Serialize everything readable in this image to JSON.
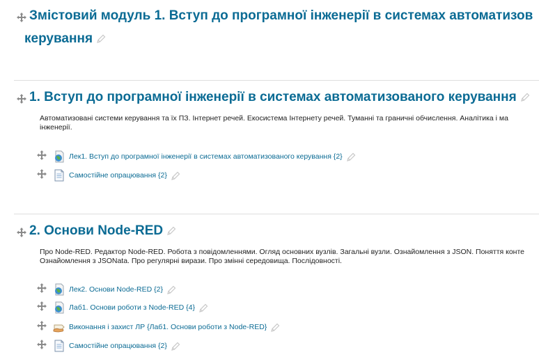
{
  "module": {
    "title_line1": "Змістовий модуль 1. Вступ до програмної інженерії в системах автоматизов",
    "title_line2": "керування"
  },
  "sections": [
    {
      "title": "1. Вступ до програмної інженерії в системах автоматизованого керування",
      "summary_line1": "Автоматизовані системи керування та їх ПЗ. Інтернет речей. Екосистема  Інтернету речей. Туманні та граничні обчислення. Аналітика і ма",
      "summary_line2": "інженерії.",
      "activities": [
        {
          "icon": "globe-icon",
          "label": "Лек1. Вступ до програмної інженерії в системах автоматизованого керування {2}"
        },
        {
          "icon": "page-icon",
          "label": "Самостійне опрацювання {2}"
        }
      ]
    },
    {
      "title": "2. Основи Node-RED",
      "summary_line1": "Про Node-RED. Редактор Node-RED. Робота з повідомленнями. Огляд основних вузлів. Загальні вузли. Ознайомлення з JSON. Поняття конте",
      "summary_line2": "Ознайомлення з JSONata. Про регулярні вирази. Про змінні середовища. Послідовності.",
      "activities": [
        {
          "icon": "globe-icon",
          "label": "Лек2. Основи Node-RED {2}"
        },
        {
          "icon": "globe-icon",
          "label": "Лаб1. Основи роботи з Node-RED {4}"
        },
        {
          "icon": "assignment-hand-icon",
          "label": "Виконання і захист ЛР {Лаб1. Основи роботи з Node-RED}"
        },
        {
          "icon": "page-icon",
          "label": "Самостійне опрацювання {2}"
        }
      ]
    }
  ]
}
